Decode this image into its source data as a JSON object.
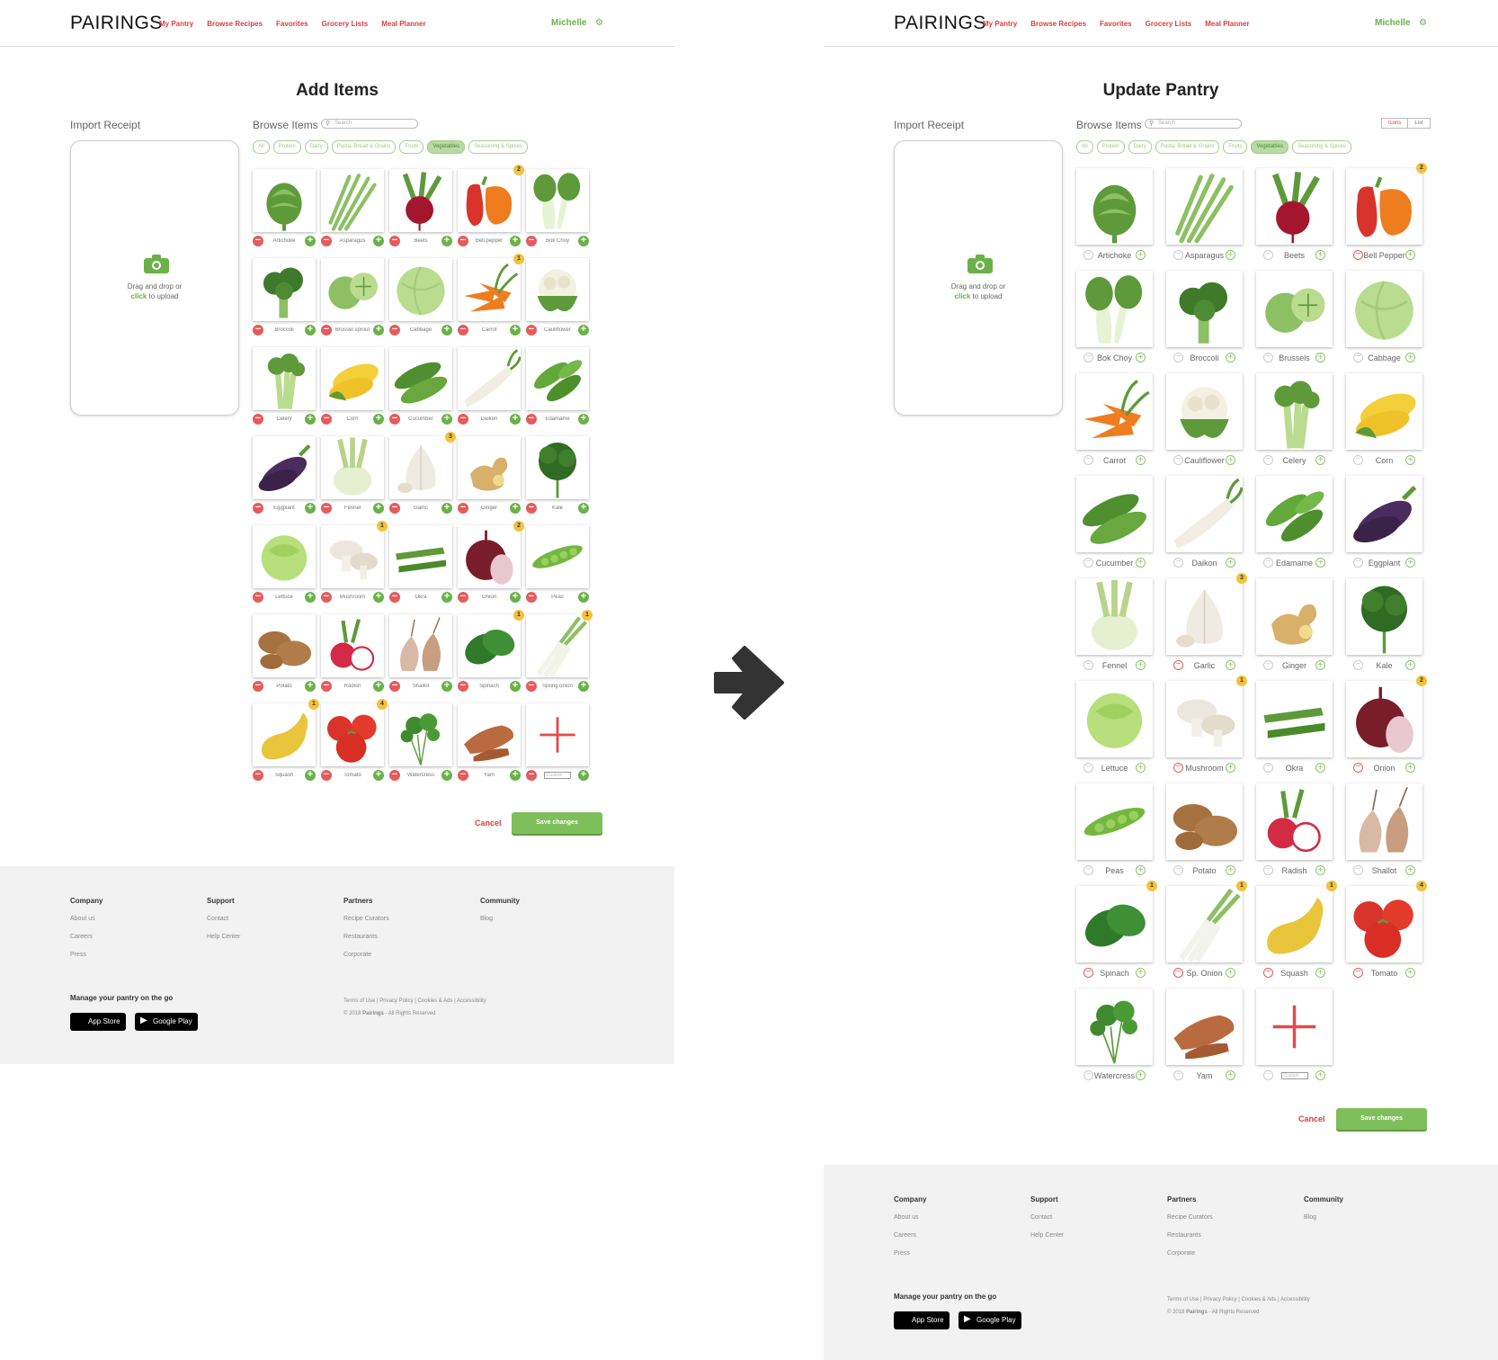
{
  "brand": "PAIRINGS",
  "nav": [
    "My Pantry",
    "Browse Recipes",
    "Favorites",
    "Grocery Lists",
    "Meal Planner"
  ],
  "user": "Michelle",
  "left": {
    "title": "Add Items",
    "import_label": "Import Receipt",
    "drop_line1": "Drag and drop or",
    "drop_click": "click",
    "drop_line2": " to upload",
    "browse_label": "Browse Items",
    "search_placeholder": "Search",
    "categories": [
      "All",
      "Protein",
      "Dairy",
      "Pasta, Bread & Grains",
      "Fruits",
      "Vegetables",
      "Seasoning & Spices"
    ],
    "active_category": "Vegetables",
    "items": [
      {
        "label": "Artichoke",
        "icon": "artichoke",
        "count": 0
      },
      {
        "label": "Asparagus",
        "icon": "asparagus",
        "count": 0
      },
      {
        "label": "Beets",
        "icon": "beet",
        "count": 0
      },
      {
        "label": "Bell pepper",
        "icon": "bell-pepper",
        "count": 2
      },
      {
        "label": "Bok Choy",
        "icon": "bok-choy",
        "count": 0
      },
      {
        "label": "Broccoli",
        "icon": "broccoli",
        "count": 0
      },
      {
        "label": "Brussel sprout",
        "icon": "brussels",
        "count": 0
      },
      {
        "label": "Cabbage",
        "icon": "cabbage",
        "count": 0
      },
      {
        "label": "Carrot",
        "icon": "carrot",
        "count": 1
      },
      {
        "label": "Cauliflower",
        "icon": "cauliflower",
        "count": 0
      },
      {
        "label": "Celery",
        "icon": "celery",
        "count": 0
      },
      {
        "label": "Corn",
        "icon": "corn",
        "count": 0
      },
      {
        "label": "Cucumber",
        "icon": "cucumber",
        "count": 0
      },
      {
        "label": "Daikon",
        "icon": "daikon",
        "count": 0
      },
      {
        "label": "Edamame",
        "icon": "edamame",
        "count": 0
      },
      {
        "label": "Eggplant",
        "icon": "eggplant",
        "count": 0
      },
      {
        "label": "Fennel",
        "icon": "fennel",
        "count": 0
      },
      {
        "label": "Garlic",
        "icon": "garlic",
        "count": 3
      },
      {
        "label": "Ginger",
        "icon": "ginger",
        "count": 0
      },
      {
        "label": "Kale",
        "icon": "kale",
        "count": 0
      },
      {
        "label": "Lettuce",
        "icon": "lettuce",
        "count": 0
      },
      {
        "label": "Mushroom",
        "icon": "mushroom",
        "count": 1
      },
      {
        "label": "Okra",
        "icon": "okra",
        "count": 0
      },
      {
        "label": "Onion",
        "icon": "onion",
        "count": 2
      },
      {
        "label": "Peas",
        "icon": "peas",
        "count": 0
      },
      {
        "label": "Potato",
        "icon": "potato",
        "count": 0
      },
      {
        "label": "Radish",
        "icon": "radish",
        "count": 0
      },
      {
        "label": "Shallot",
        "icon": "shallot",
        "count": 0
      },
      {
        "label": "Spinach",
        "icon": "spinach",
        "count": 1
      },
      {
        "label": "Spring onion",
        "icon": "spring-onion",
        "count": 1
      },
      {
        "label": "Squash",
        "icon": "squash",
        "count": 1
      },
      {
        "label": "Tomato",
        "icon": "tomato",
        "count": 4
      },
      {
        "label": "Watercress",
        "icon": "watercress",
        "count": 0
      },
      {
        "label": "Yam",
        "icon": "yam",
        "count": 0
      },
      {
        "label": "Custom",
        "icon": "add",
        "count": 0
      }
    ],
    "cancel": "Cancel",
    "save": "Save changes"
  },
  "right": {
    "title": "Update Pantry",
    "import_label": "Import Receipt",
    "drop_line1": "Drag and drop or",
    "drop_click": "click",
    "drop_line2": " to upload",
    "browse_label": "Browse Items",
    "search_placeholder": "Search",
    "view_icons": "Icons",
    "view_list": "List",
    "categories": [
      "All",
      "Protein",
      "Dairy",
      "Pasta, Bread & Grains",
      "Fruits",
      "Vegetables",
      "Seasoning & Spices"
    ],
    "active_category": "Vegetables",
    "items": [
      {
        "label": "Artichoke",
        "icon": "artichoke",
        "count": 0
      },
      {
        "label": "Asparagus",
        "icon": "asparagus",
        "count": 0
      },
      {
        "label": "Beets",
        "icon": "beet",
        "count": 0
      },
      {
        "label": "Bell Pepper",
        "icon": "bell-pepper",
        "count": 2
      },
      {
        "label": "Bok Choy",
        "icon": "bok-choy",
        "count": 0
      },
      {
        "label": "Broccoli",
        "icon": "broccoli",
        "count": 0
      },
      {
        "label": "Brussels",
        "icon": "brussels",
        "count": 0
      },
      {
        "label": "Cabbage",
        "icon": "cabbage",
        "count": 0
      },
      {
        "label": "Carrot",
        "icon": "carrot",
        "count": 0
      },
      {
        "label": "Cauliflower",
        "icon": "cauliflower",
        "count": 0
      },
      {
        "label": "Celery",
        "icon": "celery",
        "count": 0
      },
      {
        "label": "Corn",
        "icon": "corn",
        "count": 0
      },
      {
        "label": "Cucumber",
        "icon": "cucumber",
        "count": 0
      },
      {
        "label": "Daikon",
        "icon": "daikon",
        "count": 0
      },
      {
        "label": "Edamame",
        "icon": "edamame",
        "count": 0
      },
      {
        "label": "Eggplant",
        "icon": "eggplant",
        "count": 0
      },
      {
        "label": "Fennel",
        "icon": "fennel",
        "count": 0
      },
      {
        "label": "Garlic",
        "icon": "garlic",
        "count": 3
      },
      {
        "label": "Ginger",
        "icon": "ginger",
        "count": 0
      },
      {
        "label": "Kale",
        "icon": "kale",
        "count": 0
      },
      {
        "label": "Lettuce",
        "icon": "lettuce",
        "count": 0
      },
      {
        "label": "Mushroom",
        "icon": "mushroom",
        "count": 1
      },
      {
        "label": "Okra",
        "icon": "okra",
        "count": 0
      },
      {
        "label": "Onion",
        "icon": "onion",
        "count": 2
      },
      {
        "label": "Peas",
        "icon": "peas",
        "count": 0
      },
      {
        "label": "Potato",
        "icon": "potato",
        "count": 0
      },
      {
        "label": "Radish",
        "icon": "radish",
        "count": 0
      },
      {
        "label": "Shallot",
        "icon": "shallot",
        "count": 0
      },
      {
        "label": "Spinach",
        "icon": "spinach",
        "count": 1
      },
      {
        "label": "Sp. Onion",
        "icon": "spring-onion",
        "count": 1
      },
      {
        "label": "Squash",
        "icon": "squash",
        "count": 1
      },
      {
        "label": "Tomato",
        "icon": "tomato",
        "count": 4
      },
      {
        "label": "Watercress",
        "icon": "watercress",
        "count": 0
      },
      {
        "label": "Yam",
        "icon": "yam",
        "count": 0
      },
      {
        "label": "Custom",
        "icon": "add",
        "count": 0
      }
    ],
    "cancel": "Cancel",
    "save": "Save changes"
  },
  "footer": {
    "columns": [
      {
        "title": "Company",
        "links": [
          "About us",
          "Careers",
          "Press"
        ]
      },
      {
        "title": "Support",
        "links": [
          "Contact",
          "Help Center"
        ]
      },
      {
        "title": "Partners",
        "links": [
          "Recipe Curators",
          "Restaurants",
          "Corporate"
        ]
      },
      {
        "title": "Community",
        "links": [
          "Blog"
        ]
      }
    ],
    "app_heading": "Manage your pantry on the go",
    "app_store": "App Store",
    "google_play": "Google Play",
    "legal_links": "Terms of Use  |  Privacy Policy  |  Cookies & Ads  |  Accessibility",
    "copyright_pre": "© 2018 ",
    "copyright_brand": "Pairings",
    "copyright_post": " - All Rights Reserved"
  },
  "colors": {
    "accent_red": "#d94040",
    "accent_green": "#6bb14a",
    "badge": "#f2c33a"
  }
}
